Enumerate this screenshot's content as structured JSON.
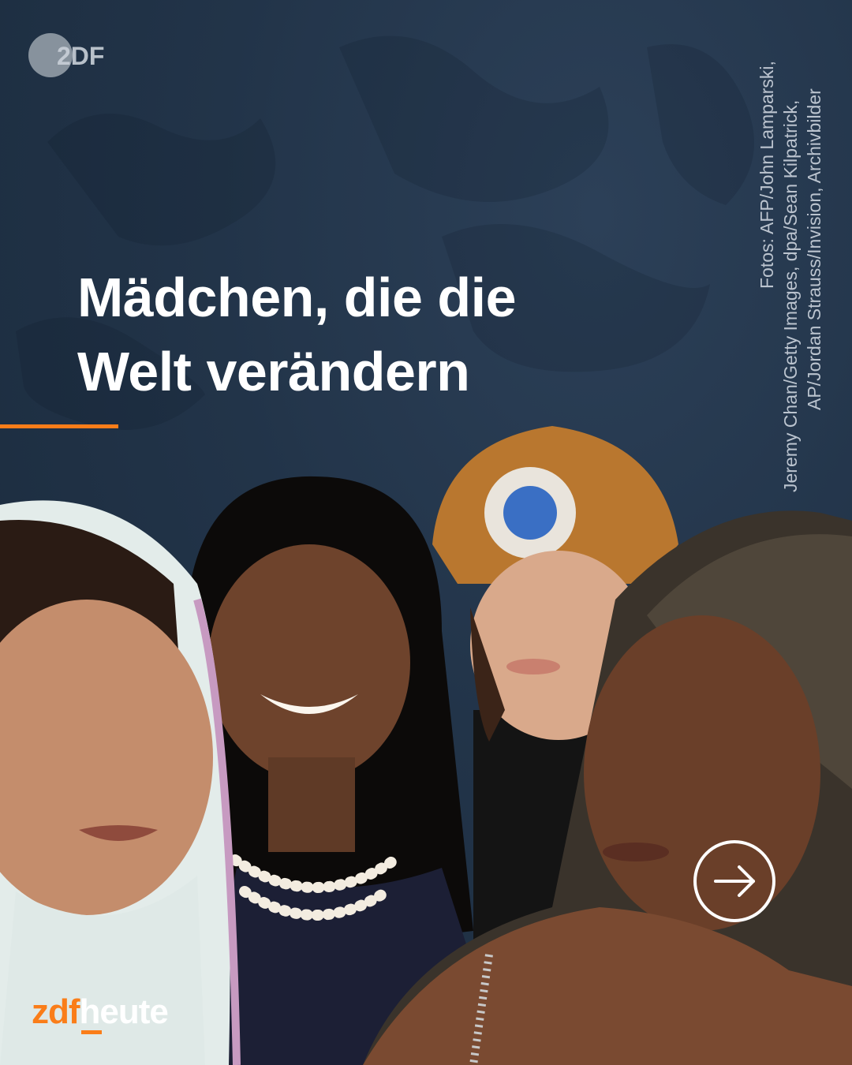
{
  "logo": {
    "text": "2DF",
    "icon": "zdf-logo-icon"
  },
  "photo_credit": {
    "lines": [
      "Fotos: AFP/John Lamparski,",
      "Jeremy Chan/Getty Images, dpa/Sean Kilpatrick,",
      "AP/Jordan Strauss/Invision, Archivbilder"
    ]
  },
  "headline": {
    "line1": "Mädchen, die die",
    "line2": "Welt verändern"
  },
  "brand": {
    "part1": "zdf",
    "part2": "heute"
  },
  "next_button": {
    "icon": "arrow-right-circle-icon"
  },
  "colors": {
    "background": "#223449",
    "accent": "#fa7d19",
    "text": "#ffffff"
  }
}
